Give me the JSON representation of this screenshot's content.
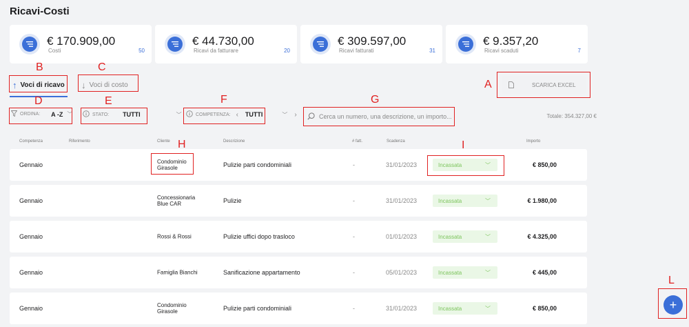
{
  "page": {
    "title": "Ricavi-Costi"
  },
  "cards": [
    {
      "amount": "€ 170.909,00",
      "label": "Costi",
      "count": "50"
    },
    {
      "amount": "€ 44.730,00",
      "label": "Ricavi da fatturare",
      "count": "20"
    },
    {
      "amount": "€ 309.597,00",
      "label": "Ricavi fatturati",
      "count": "31"
    },
    {
      "amount": "€ 9.357,20",
      "label": "Ricavi scaduti",
      "count": "7"
    }
  ],
  "tabs": {
    "ricavo": "Voci di ricavo",
    "costo": "Voci di costo"
  },
  "toolbar": {
    "excel_label": "SCARICA EXCEL",
    "ordina_label": "ORDINA:",
    "ordina_value": "A -Z",
    "stato_label": "STATO:",
    "stato_value": "TUTTI",
    "competenza_label": "COMPETENZA:",
    "competenza_value": "TUTTI",
    "search_placeholder": "Cerca un numero, una descrizione, un importo...",
    "totale": "Totale: 354.327,00 €"
  },
  "table": {
    "headers": {
      "competenza": "Competenza",
      "riferimento": "Riferimento",
      "cliente": "Cliente",
      "descrizione": "Descrizione",
      "nfatt": "# fatt.",
      "scadenza": "Scadenza",
      "importo": "Importo"
    },
    "rows": [
      {
        "month": "Gennaio",
        "client": "Condominio Girasole",
        "desc": "Pulizie parti condominiali",
        "nfatt": "-",
        "date": "31/01/2023",
        "status": "Incassata",
        "amount": "€ 850,00"
      },
      {
        "month": "Gennaio",
        "client": "Concessionaria Blue CAR",
        "desc": "Pulizie",
        "nfatt": "-",
        "date": "31/01/2023",
        "status": "Incassata",
        "amount": "€ 1.980,00"
      },
      {
        "month": "Gennaio",
        "client": "Rossi & Rossi",
        "desc": "Pulizie uffici dopo trasloco",
        "nfatt": "-",
        "date": "01/01/2023",
        "status": "Incassata",
        "amount": "€ 4.325,00"
      },
      {
        "month": "Gennaio",
        "client": "Famiglia Bianchi",
        "desc": "Sanificazione appartamento",
        "nfatt": "-",
        "date": "05/01/2023",
        "status": "Incassata",
        "amount": "€ 445,00"
      },
      {
        "month": "Gennaio",
        "client": "Condominio Girasole",
        "desc": "Pulizie parti condominiali",
        "nfatt": "-",
        "date": "31/01/2023",
        "status": "Incassata",
        "amount": "€ 850,00"
      }
    ]
  },
  "annotations": {
    "A": "A",
    "B": "B",
    "C": "C",
    "D": "D",
    "E": "E",
    "F": "F",
    "G": "G",
    "H": "H",
    "I": "I",
    "L": "L"
  },
  "fab": {
    "symbol": "+"
  }
}
